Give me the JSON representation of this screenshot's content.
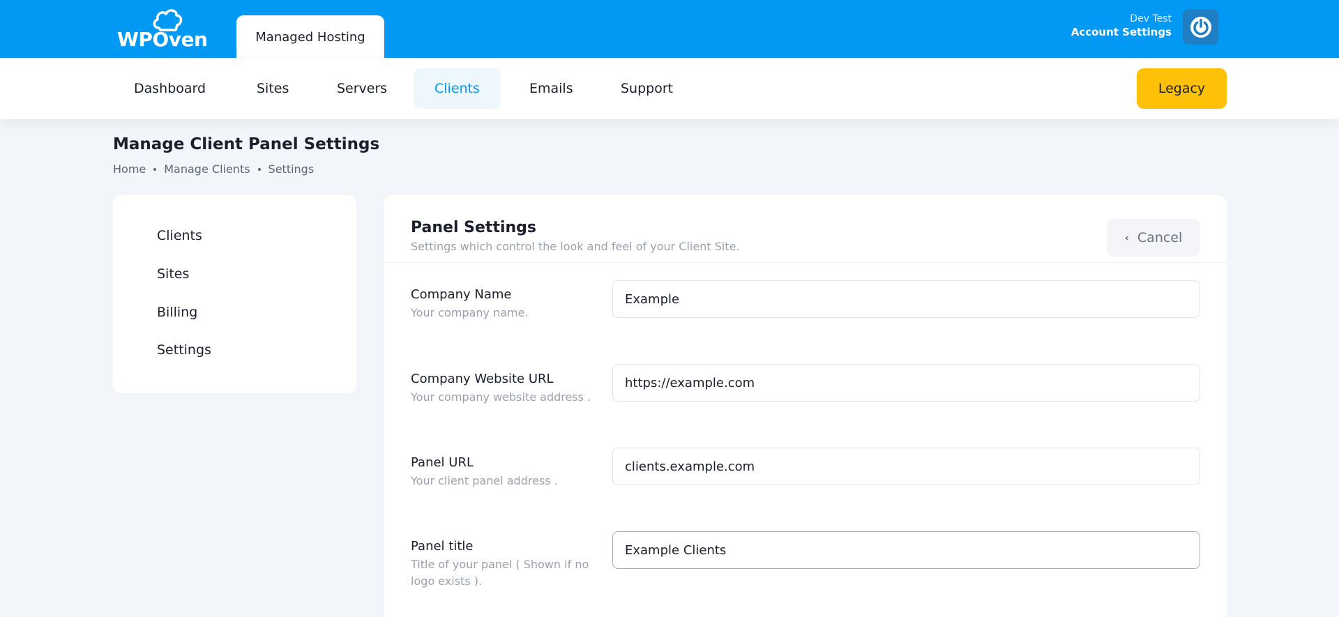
{
  "brand": {
    "logo_text": "WPOven",
    "product_tab": "Managed Hosting"
  },
  "account": {
    "user_name": "Dev Test",
    "settings_label": "Account Settings"
  },
  "nav": {
    "items": [
      {
        "label": "Dashboard"
      },
      {
        "label": "Sites"
      },
      {
        "label": "Servers"
      },
      {
        "label": "Clients",
        "active": true
      },
      {
        "label": "Emails"
      },
      {
        "label": "Support"
      }
    ],
    "legacy_label": "Legacy"
  },
  "page": {
    "title": "Manage Client Panel Settings",
    "breadcrumb": [
      "Home",
      "Manage Clients",
      "Settings"
    ]
  },
  "sidebar": {
    "items": [
      {
        "label": "Clients"
      },
      {
        "label": "Sites"
      },
      {
        "label": "Billing"
      },
      {
        "label": "Settings"
      }
    ]
  },
  "panel": {
    "title": "Panel Settings",
    "subtitle": "Settings which control the look and feel of your Client Site.",
    "cancel_label": "Cancel",
    "fields": [
      {
        "label": "Company Name",
        "help": "Your company name.",
        "value": "Example"
      },
      {
        "label": "Company Website URL",
        "help": "Your company website address .",
        "value": "https://example.com"
      },
      {
        "label": "Panel URL",
        "help": "Your client panel address .",
        "value": "clients.example.com"
      },
      {
        "label": "Panel title",
        "help": "Title of your panel ( Shown if no logo exists ).",
        "value": "Example Clients"
      }
    ]
  },
  "colors": {
    "brand_blue": "#0199f4",
    "legacy_yellow": "#fec107",
    "active_nav_bg": "#eef7fd",
    "page_bg": "#f2f5f9"
  },
  "icons": [
    "cloud-logo-icon",
    "power-icon",
    "chevron-left-icon"
  ]
}
